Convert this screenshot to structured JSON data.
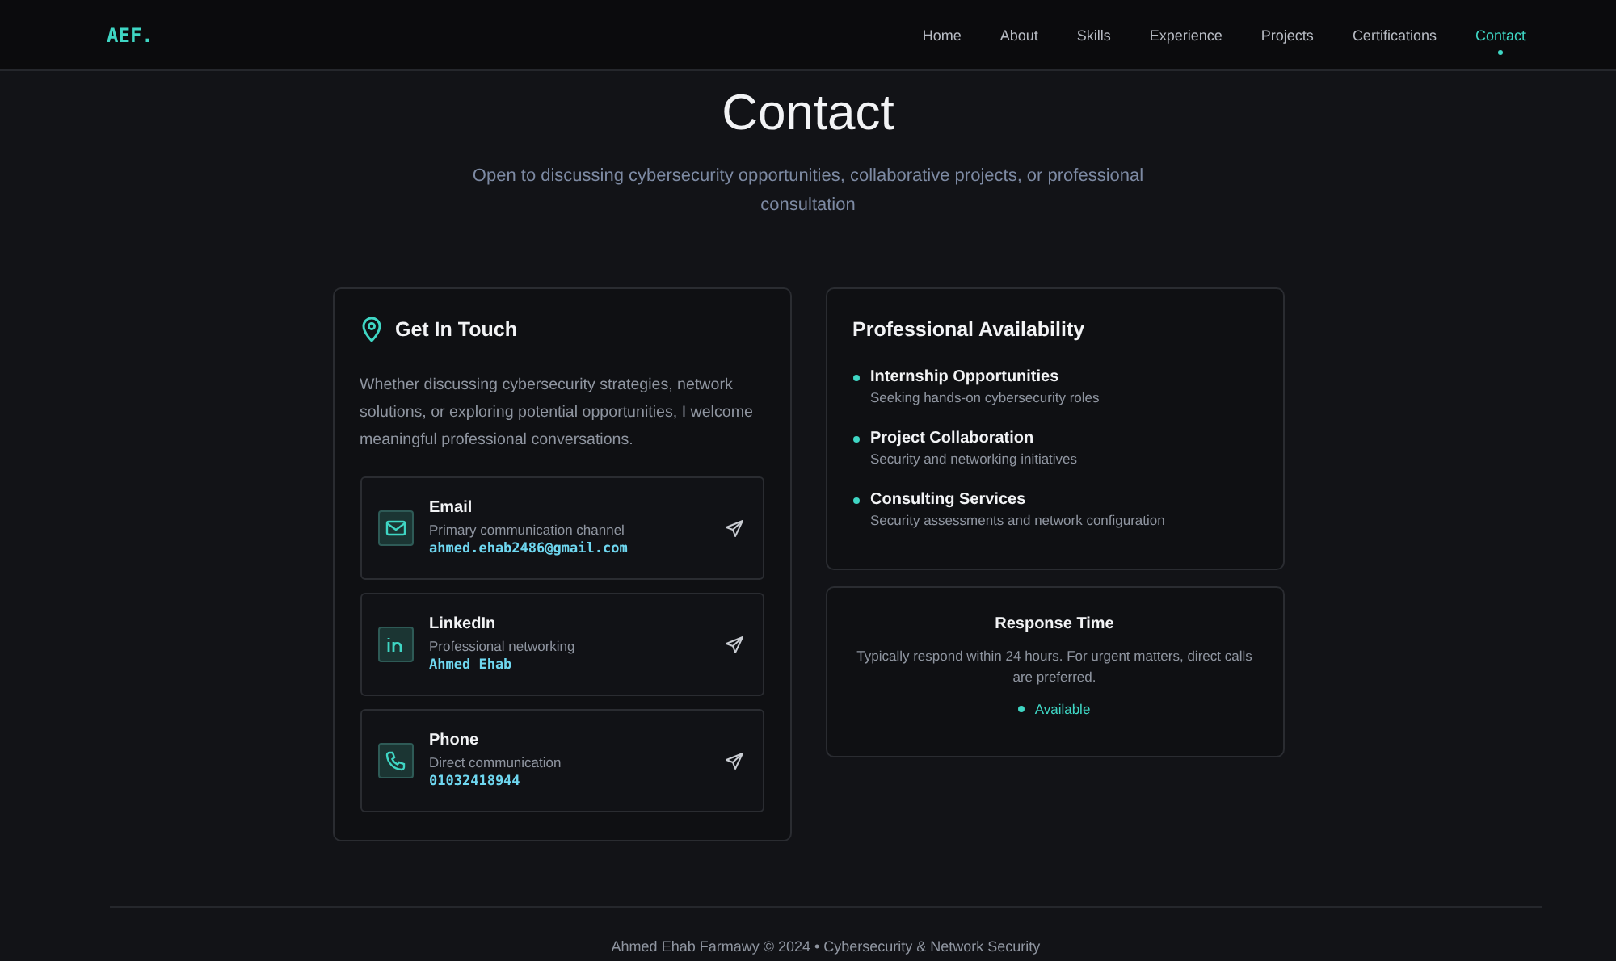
{
  "nav": {
    "logo": "AEF.",
    "links": [
      {
        "label": "Home",
        "selected": false
      },
      {
        "label": "About",
        "selected": false
      },
      {
        "label": "Skills",
        "selected": false
      },
      {
        "label": "Experience",
        "selected": false
      },
      {
        "label": "Projects",
        "selected": false
      },
      {
        "label": "Certifications",
        "selected": false
      },
      {
        "label": "Contact",
        "selected": true
      }
    ]
  },
  "header": {
    "title": "Contact",
    "subtitle": "Open to discussing cybersecurity opportunities, collaborative projects, or professional consultation"
  },
  "get_in_touch": {
    "title": "Get In Touch",
    "intro": "Whether discussing cybersecurity strategies, network solutions, or exploring potential opportunities, I welcome meaningful professional conversations.",
    "methods": [
      {
        "kind": "email",
        "title": "Email",
        "description": "Primary communication channel",
        "value": "ahmed.ehab2486@gmail.com"
      },
      {
        "kind": "linkedin",
        "title": "LinkedIn",
        "description": "Professional networking",
        "value": "Ahmed Ehab"
      },
      {
        "kind": "phone",
        "title": "Phone",
        "description": "Direct communication",
        "value": "01032418944"
      }
    ]
  },
  "availability": {
    "title": "Professional Availability",
    "items": [
      {
        "title": "Internship Opportunities",
        "description": "Seeking hands-on cybersecurity roles"
      },
      {
        "title": "Project Collaboration",
        "description": "Security and networking initiatives"
      },
      {
        "title": "Consulting Services",
        "description": "Security assessments and network configuration"
      }
    ]
  },
  "response_time": {
    "title": "Response Time",
    "text": "Typically respond within 24 hours. For urgent matters, direct calls are preferred.",
    "status": "Available"
  },
  "footer": {
    "text": "Ahmed Ehab Farmawy © 2024 • Cybersecurity & Network Security"
  }
}
